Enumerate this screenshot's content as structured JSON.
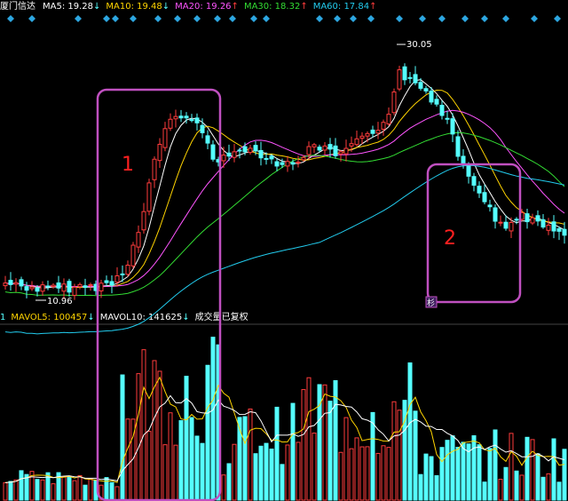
{
  "price_header": {
    "stock_name": "厦门信达",
    "ma_items": [
      {
        "label": "MA5: 19.28",
        "arrow": "↓",
        "color": "#ffffff"
      },
      {
        "label": "MA10: 19.48",
        "arrow": "↓",
        "color": "#ffd400"
      },
      {
        "label": "MA20: 19.26",
        "arrow": "↑",
        "color": "#ff55ff"
      },
      {
        "label": "MA30: 18.32",
        "arrow": "↑",
        "color": "#33dd33"
      },
      {
        "label": "MA60: 17.84",
        "arrow": "↑",
        "color": "#22ccee"
      }
    ]
  },
  "volume_header": {
    "prefix": "1",
    "mavol5": "MAVOL5: 100457",
    "mavol5_arrow": "↓",
    "mavol10": "MAVOL10: 141625",
    "mavol10_arrow": "↓",
    "note": "成交量已复权"
  },
  "annotations": {
    "high_label": "30.05",
    "low_label": "10.96",
    "box1_label": "1",
    "box2_label": "2",
    "tag_label": "杉"
  },
  "colors": {
    "up": "#ff3c3c",
    "down": "#55ffff",
    "box": "#c050c0",
    "marker": "#2da6e0",
    "box_label": "#ff2020"
  },
  "chart_data": {
    "type": "candlestick",
    "price_markers": {
      "high": 30.05,
      "low": 10.96
    },
    "moving_averages": [
      "MA5",
      "MA10",
      "MA20",
      "MA30",
      "MA60"
    ],
    "volume_averages": {
      "MAVOL5": 100457,
      "MAVOL10": 141625
    }
  }
}
